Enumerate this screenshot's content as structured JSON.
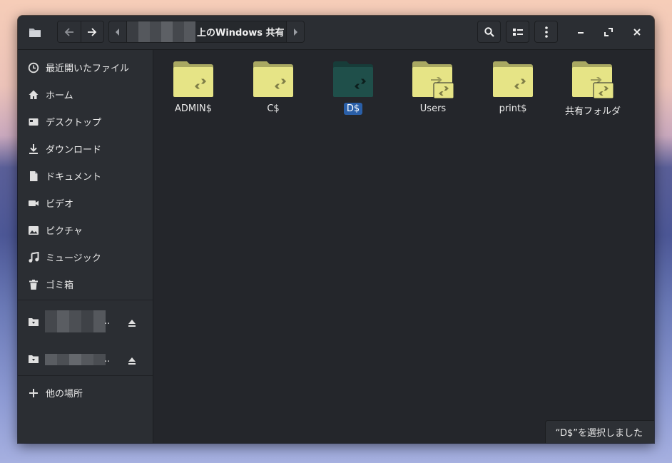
{
  "header": {
    "path_label": "上のWindows 共有",
    "buttons": [
      "back",
      "forward",
      "search",
      "view-toggle",
      "menu",
      "minimize",
      "maximize",
      "close"
    ]
  },
  "sidebar": {
    "items": [
      {
        "label": "最近開いたファイル",
        "icon": "clock-icon"
      },
      {
        "label": "ホーム",
        "icon": "home-icon"
      },
      {
        "label": "デスクトップ",
        "icon": "desktop-icon"
      },
      {
        "label": "ダウンロード",
        "icon": "download-icon"
      },
      {
        "label": "ドキュメント",
        "icon": "document-icon"
      },
      {
        "label": "ビデオ",
        "icon": "video-icon"
      },
      {
        "label": "ピクチャ",
        "icon": "picture-icon"
      },
      {
        "label": "ミュージック",
        "icon": "music-icon"
      },
      {
        "label": "ゴミ箱",
        "icon": "trash-icon"
      }
    ],
    "network_mounts": [
      {
        "label": "..",
        "icon": "network-folder-icon"
      },
      {
        "label": "..",
        "icon": "network-folder-icon"
      }
    ],
    "other_locations": "他の場所"
  },
  "files": [
    {
      "name": "ADMIN$",
      "selected": false
    },
    {
      "name": "C$",
      "selected": false
    },
    {
      "name": "D$",
      "selected": true
    },
    {
      "name": "Users",
      "selected": false
    },
    {
      "name": "print$",
      "selected": false
    },
    {
      "name": "共有フォルダ",
      "selected": false
    }
  ],
  "status": {
    "text": "“D$”を選択しました"
  },
  "colors": {
    "folder": "#e6e486",
    "folder_selected": "#1f4f4a",
    "selection": "#2a5fa8",
    "window_bg": "#24262b",
    "sidebar_bg": "#2b2e33"
  }
}
